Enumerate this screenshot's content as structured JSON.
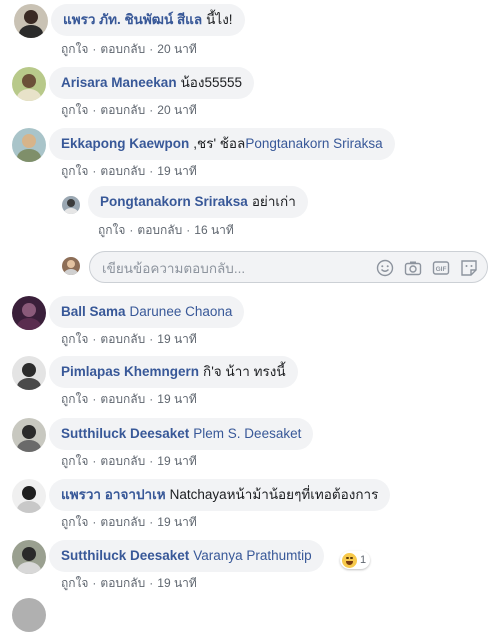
{
  "labels": {
    "like": "ถูกใจ",
    "reply": "ตอบกลับ",
    "separator": "·"
  },
  "reply_box": {
    "placeholder": "เขียนข้อความตอบกลับ..."
  },
  "reply_box_icons": [
    "emoji-icon",
    "camera-icon",
    "gif-icon",
    "sticker-icon"
  ],
  "colors": {
    "author": "#385898",
    "bubble": "#f2f3f5",
    "meta": "#606770"
  },
  "comments": [
    {
      "author": "แพรว ภัท. ชินพัฒน์ สีแล",
      "text": "นี้ไง!",
      "time": "20 นาที"
    },
    {
      "author": "Arisara Maneekan",
      "text": "น้อง55555",
      "time": "20 นาที"
    },
    {
      "author": "Ekkapong Kaewpon",
      "text": ",ชร' ช้อล",
      "tag": "Pongtanakorn Sriraksa",
      "time": "19 นาที"
    },
    {
      "author": "Pongtanakorn Sriraksa",
      "text": "อย่าเก่า",
      "time": "16 นาที"
    },
    {
      "author": "Ball Sama",
      "text": "Darunee Chaona",
      "time": "19 นาที"
    },
    {
      "author": "Pimlapas Khemngern",
      "text": "กิ'จ น้าา ทรงนี้",
      "time": "19 นาที"
    },
    {
      "author": "Sutthiluck Deesaket",
      "text": "Plem S. Deesaket",
      "time": "19 นาที"
    },
    {
      "author": "แพรวา อาจาปาเห",
      "text": "Natchayaหน้าม้าน้อยๆที่เทอต้องการ",
      "time": "19 นาที"
    },
    {
      "author": "Sutthiluck Deesaket",
      "text": "Varanya Prathumtip",
      "time": "19 นาที",
      "reaction_count": "1"
    }
  ]
}
